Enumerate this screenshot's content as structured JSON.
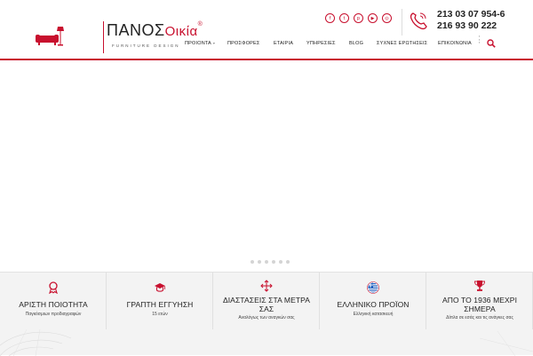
{
  "logo": {
    "brand_part1": "ΠΑΝΟΣ",
    "brand_part2": "Οικία",
    "registered": "®",
    "tagline": "FURNITURE DESIGN"
  },
  "social": [
    {
      "icon": "facebook-icon",
      "glyph": "f"
    },
    {
      "icon": "twitter-icon",
      "glyph": "t"
    },
    {
      "icon": "pinterest-icon",
      "glyph": "p"
    },
    {
      "icon": "youtube-icon",
      "glyph": "▶"
    },
    {
      "icon": "instagram-icon",
      "glyph": "◎"
    }
  ],
  "contact": {
    "phone1": "213 03 07 954-6",
    "phone2": "216 93 90 222"
  },
  "nav": {
    "items": [
      {
        "label": "ΠΡΟΙΟΝΤΑ",
        "has_caret": true
      },
      {
        "label": "ΠΡΟΣΦΟΡΕΣ"
      },
      {
        "label": "ΕΤΑΙΡΙΑ"
      },
      {
        "label": "ΥΠΗΡΕΣΙΕΣ"
      },
      {
        "label": "BLOG"
      },
      {
        "label": "ΣΥΧΝΕΣ ΕΡΩΤΗΣΕΙΣ"
      },
      {
        "label": "ΕΠΙΚΟΙΝΩΝΙΑ"
      }
    ],
    "caret": "▾"
  },
  "slider": {
    "dot_count": 6
  },
  "features": [
    {
      "icon": "award-ribbon-icon",
      "title": "ΑΡΙΣΤΗ ΠΟΙΟΤΗΤΑ",
      "subtitle": "Παγκόσμιων προδιαγραφών"
    },
    {
      "icon": "graduation-cap-icon",
      "title": "ΓΡΑΠΤΗ ΕΓΓΥΗΣΗ",
      "subtitle": "15 ετών"
    },
    {
      "icon": "move-arrows-icon",
      "title": "ΔΙΑΣΤΑΣΕΙΣ ΣΤΑ ΜΕΤΡΑ ΣΑΣ",
      "subtitle": "Αναλόγως των αναγκών σας"
    },
    {
      "icon": "greek-flag-icon",
      "title": "ΕΛΛΗΝΙΚΟ ΠΡΟΪΟΝ",
      "subtitle": "Ελληνική κατασκευή"
    },
    {
      "icon": "trophy-icon",
      "title": "ΑΠΟ ΤΟ 1936 ΜΕΧΡΙ ΣΗΜΕΡΑ",
      "subtitle": "Δίπλα σε εσάς και τις ανάγκες σας"
    }
  ],
  "colors": {
    "brand_red": "#c8102e",
    "feature_bg": "#f3f3f3"
  }
}
